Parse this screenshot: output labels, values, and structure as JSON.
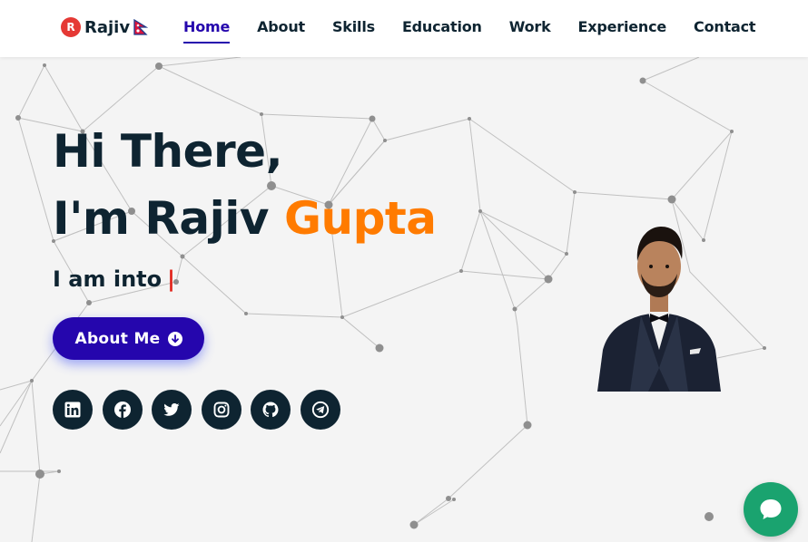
{
  "brand": {
    "badge": "R",
    "name": "Rajiv",
    "flag_icon": "nepal-flag-icon"
  },
  "nav": {
    "items": [
      {
        "label": "Home",
        "active": true
      },
      {
        "label": "About",
        "active": false
      },
      {
        "label": "Skills",
        "active": false
      },
      {
        "label": "Education",
        "active": false
      },
      {
        "label": "Work",
        "active": false
      },
      {
        "label": "Experience",
        "active": false
      },
      {
        "label": "Contact",
        "active": false
      }
    ]
  },
  "hero": {
    "greeting": "Hi There,",
    "intro_prefix": "I'm Rajiv ",
    "intro_accent": "Gupta",
    "typing_prefix": "I am into",
    "typing_cursor": "|",
    "about_button": "About Me"
  },
  "socials": [
    {
      "icon": "linkedin-icon"
    },
    {
      "icon": "facebook-icon"
    },
    {
      "icon": "twitter-icon"
    },
    {
      "icon": "instagram-icon"
    },
    {
      "icon": "github-icon"
    },
    {
      "icon": "telegram-icon"
    }
  ],
  "colors": {
    "primary": "#2506ad",
    "dark": "#0e2431",
    "accent": "#ff7b00",
    "cursor": "#e2231a",
    "chat": "#1aa36f",
    "background": "#f4f4f4"
  }
}
